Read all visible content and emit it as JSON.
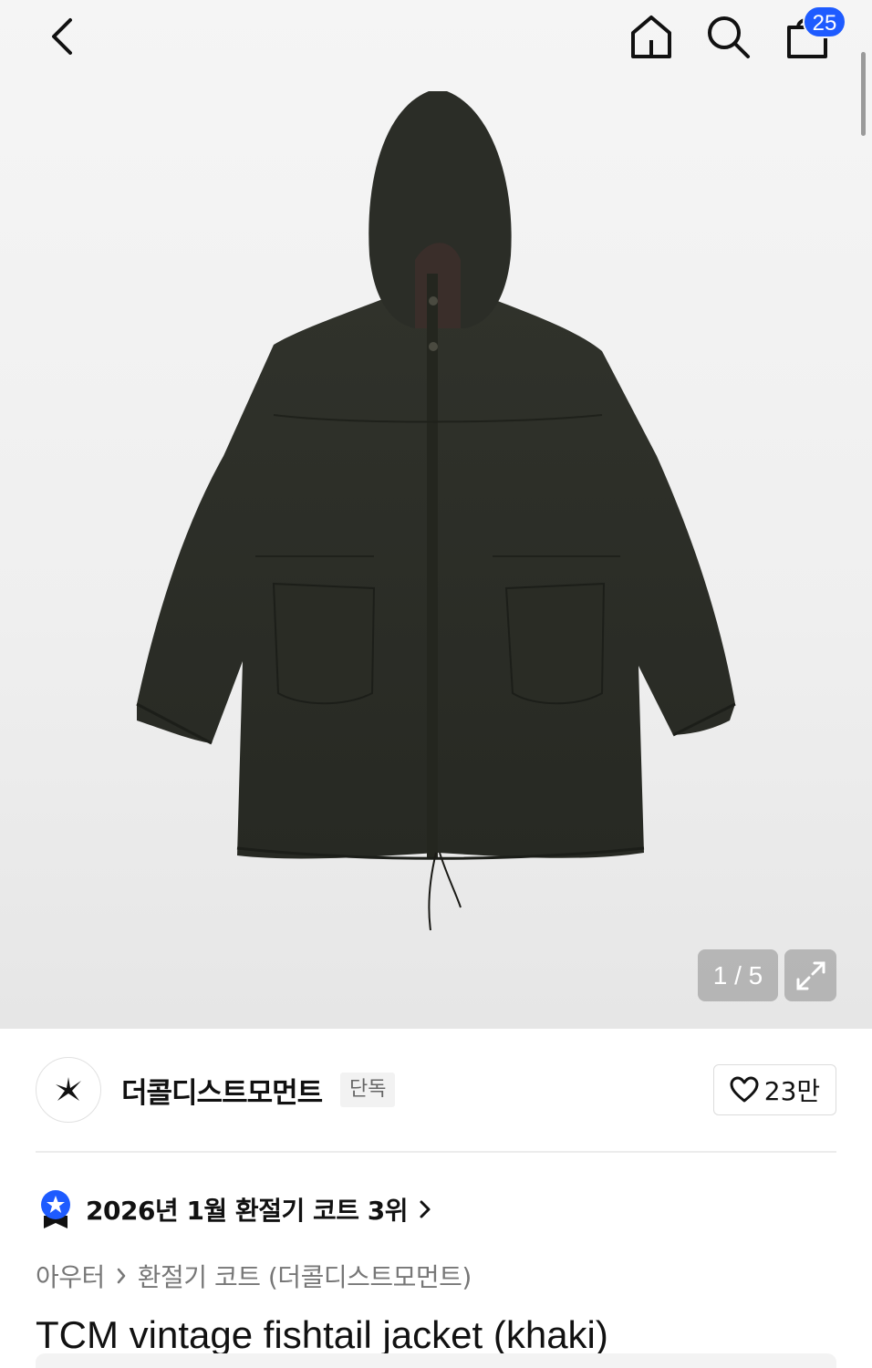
{
  "header": {
    "back_icon": "chevron-left-icon",
    "home_icon": "home-icon",
    "search_icon": "search-icon",
    "cart_icon": "shopping-bag-icon",
    "cart_count": "25"
  },
  "gallery": {
    "pager": "1 / 5",
    "expand_icon": "expand-icon"
  },
  "brand": {
    "name": "더콜디스트모먼트",
    "tag": "단독",
    "like_count": "23만",
    "logo_icon": "brand-star-logo-icon"
  },
  "ranking": {
    "text": "2026년 1월 환절기 코트 3위",
    "badge_icon": "blue-star-medal-icon"
  },
  "breadcrumb": {
    "level1": "아우터",
    "level2": "환절기 코트 (더콜디스트모먼트)"
  },
  "product": {
    "title": "TCM vintage fishtail jacket (khaki)"
  },
  "colors": {
    "accent": "#1e5bff",
    "jacket": "#2d2f29"
  }
}
